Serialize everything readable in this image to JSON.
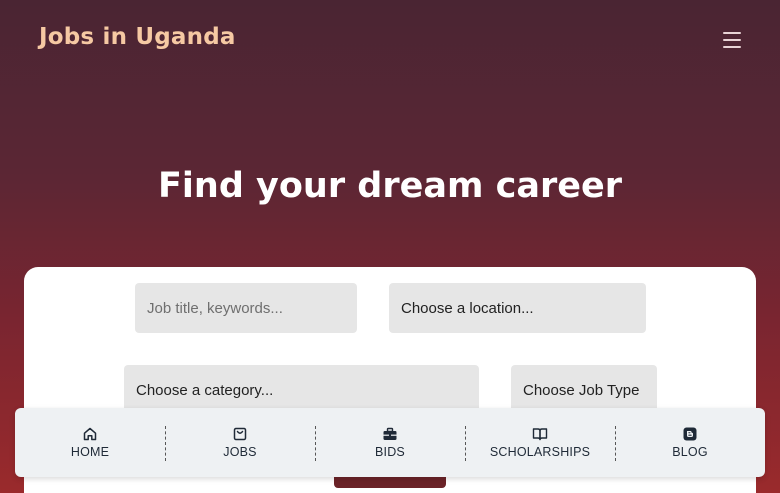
{
  "header": {
    "brand": "Jobs in Uganda",
    "menu_icon": "hamburger-menu-icon"
  },
  "hero": {
    "title": "Find your dream career"
  },
  "search": {
    "keyword_placeholder": "Job title, keywords...",
    "location_label": "Choose a location...",
    "category_label": "Choose a category...",
    "jobtype_label": "Choose Job Type"
  },
  "bottom_nav": {
    "items": [
      {
        "label": "HOME",
        "icon": "home-icon"
      },
      {
        "label": "JOBS",
        "icon": "shopping-bag-icon"
      },
      {
        "label": "BIDS",
        "icon": "briefcase-icon"
      },
      {
        "label": "SCHOLARSHIPS",
        "icon": "book-open-icon"
      },
      {
        "label": "BLOG",
        "icon": "blogger-icon"
      }
    ]
  },
  "colors": {
    "brand": "#f6c9a3",
    "button": "#6b2328",
    "nav_bg": "#eef1f3"
  }
}
